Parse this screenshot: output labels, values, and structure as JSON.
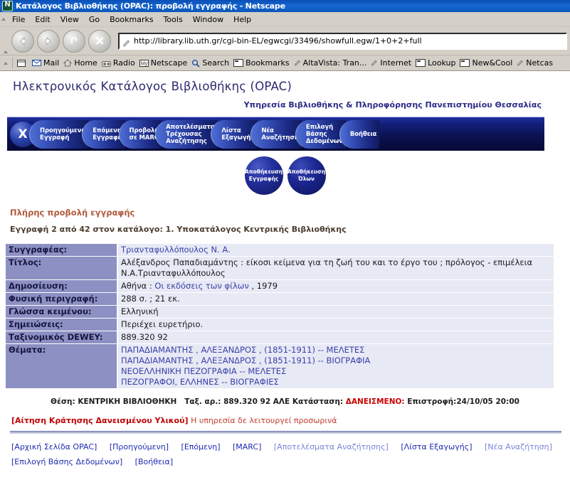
{
  "window": {
    "title": "Κατάλογος Βιβλιοθήκης (OPAC): προβολή εγγραφής - Netscape",
    "logo_icon": "netscape-logo-icon"
  },
  "menubar": {
    "items": [
      {
        "label": "File"
      },
      {
        "label": "Edit"
      },
      {
        "label": "View"
      },
      {
        "label": "Go"
      },
      {
        "label": "Bookmarks"
      },
      {
        "label": "Tools"
      },
      {
        "label": "Window"
      },
      {
        "label": "Help"
      }
    ]
  },
  "toolbar": {
    "back_icon": "back-arrow-icon",
    "forward_icon": "forward-arrow-icon",
    "reload_icon": "reload-icon",
    "stop_icon": "stop-icon",
    "url_icon": "pen-icon",
    "url": "http://library.lib.uth.gr/cgi-bin-EL/egwcgi/33496/showfull.egw/1+0+2+full"
  },
  "bookmarkbar": {
    "items": [
      {
        "label": "",
        "icon": "window-icon"
      },
      {
        "label": "Mail",
        "icon": "mail-icon"
      },
      {
        "label": "Home",
        "icon": "home-icon"
      },
      {
        "label": "Radio",
        "icon": "radio-icon"
      },
      {
        "label": "Netscape",
        "icon": "my-netscape-icon"
      },
      {
        "label": "Search",
        "icon": "search-icon"
      },
      {
        "label": "Bookmarks",
        "icon": "folder-icon"
      },
      {
        "label": "AltaVista: Tran...",
        "icon": "bookmark-icon"
      },
      {
        "label": "Internet",
        "icon": "bookmark-icon"
      },
      {
        "label": "Lookup",
        "icon": "folder-icon"
      },
      {
        "label": "New&Cool",
        "icon": "folder-icon"
      },
      {
        "label": "Netcas",
        "icon": "bookmark-icon"
      }
    ]
  },
  "page": {
    "title": "Ηλεκτρονικός Κατάλογος Βιβλιοθήκης (OPAC)",
    "subtitle": "Υπηρεσία Βιβλιοθήκης & Πληροφόρησης Πανεπιστημίου Θεσσαλίας",
    "section_heading": "Πλήρης προβολή εγγραφής",
    "record_counter": "Εγγραφή 2 από 42 στον κατάλογο: 1. Υποκατάλογος Κεντρικής Βιβλιοθήκης"
  },
  "navstrip": {
    "close_label": "X",
    "buttons": [
      {
        "label": "Προηγούμενη\nΕγγραφή"
      },
      {
        "label": "Επόμενη\nΕγγραφή"
      },
      {
        "label": "Προβολή\nσε MARC"
      },
      {
        "label": "Αποτελέσματα\nΤρέχουσας\nΑναζήτησης"
      },
      {
        "label": "Λίστα\nΕξαγωγής"
      },
      {
        "label": "Νέα\nΑναζήτηση"
      },
      {
        "label": "Επιλογή\nΒάσης\nΔεδομένων"
      },
      {
        "label": "Βοήθεια"
      }
    ]
  },
  "save_buttons": [
    {
      "label": "Αποθήκευση\nΕγγραφής"
    },
    {
      "label": "Αποθήκευση\nΌλων"
    }
  ],
  "record": {
    "rows": [
      {
        "label": "Συγγραφέας:",
        "value": "Τριανταφυλλόπουλος Ν. Α.",
        "style": "link"
      },
      {
        "label": "Τίτλος:",
        "value": "Αλέξανδρος Παπαδιαμάντης : είκοσι κείμενα για τη ζωή του και το έργο του ; πρόλογος - επιμέλεια Ν.Α.Τριανταφυλλόπουλος",
        "style": "plain"
      },
      {
        "label": "Δημοσίευση:",
        "value_prefix": "Αθήνα : ",
        "value_link": "Οι εκδόσεις των φίλων",
        "value_suffix": " , 1979",
        "style": "mixed"
      },
      {
        "label": "Φυσική περιγραφή:",
        "value": "288 σ. ; 21 εκ.",
        "style": "plain"
      },
      {
        "label": "Γλώσσα κειμένου:",
        "value": "Ελληνική",
        "style": "plain"
      },
      {
        "label": "Σημειώσεις:",
        "value": "Περιέχει ευρετήριο.",
        "style": "plain"
      },
      {
        "label": "Ταξινομικός DEWEY:",
        "value": "889.320 92",
        "style": "plain"
      },
      {
        "label": "Θέματα:",
        "values": [
          "ΠΑΠΑΔΙΑΜΑΝΤΗΣ , ΑΛΕΞΑΝΔΡΟΣ , (1851-1911) -- ΜΕΛΕΤΕΣ",
          "ΠΑΠΑΔΙΑΜΑΝΤΗΣ , ΑΛΕΞΑΝΔΡΟΣ , (1851-1911) -- ΒΙΟΓΡΑΦΙΑ",
          "ΝΕΟΕΛΛΗΝΙΚΗ ΠΕΖΟΓΡΑΦΙΑ -- ΜΕΛΕΤΕΣ",
          "ΠΕΖΟΓΡΑΦΟΙ, ΕΛΛΗΝΕΣ -- ΒΙΟΓΡΑΦΙΕΣ"
        ],
        "style": "link-list"
      }
    ]
  },
  "holdings": {
    "location_label": "Θέση:",
    "location_value": "ΚΕΝΤΡΙΚΗ ΒΙΒΛΙΟΘΗΚΗ",
    "callno_label": "Ταξ. αρ.:",
    "callno_value": "889.320 92 ΑΛΕ",
    "status_label": "Κατάσταση:",
    "status_value": "ΔΑΝΕΙΣΜΕΝΟ:",
    "due_label": "Επιστροφή:",
    "due_value": "24/10/05 20:00",
    "status_color": "#cc0000"
  },
  "reserve": {
    "link": "[Αίτηση Κράτησης Δανεισμένου Υλικού]",
    "note": "Η υπηρεσία δε λειτουργεί προσωρινά"
  },
  "footer": {
    "links": [
      {
        "label": "[Αρχική Σελίδα OPAC]",
        "dim": false
      },
      {
        "label": "[Προηγούμενη]",
        "dim": false
      },
      {
        "label": "[Επόμενη]",
        "dim": false
      },
      {
        "label": "[MARC]",
        "dim": false
      },
      {
        "label": "[Αποτελέσματα Αναζήτησης]",
        "dim": true
      },
      {
        "label": "[Λίστα Εξαγωγής]",
        "dim": false
      },
      {
        "label": "[Νέα Αναζήτηση]",
        "dim": true
      }
    ],
    "links2": [
      {
        "label": "[Επιλογή Βάσης Δεδομένων]"
      },
      {
        "label": "[Βοήθεια]"
      }
    ]
  }
}
